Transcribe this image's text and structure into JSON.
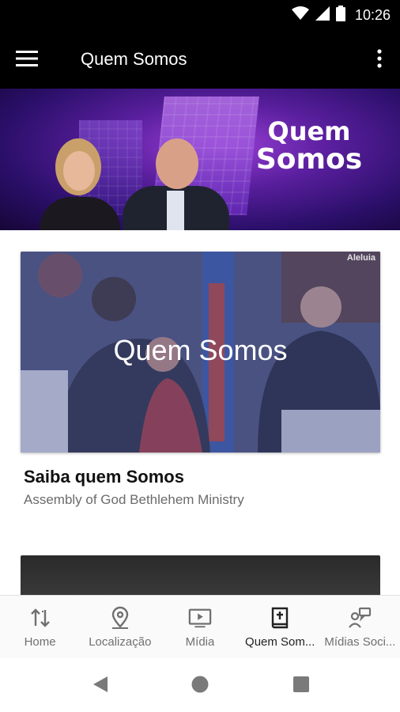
{
  "status_bar": {
    "time": "10:26"
  },
  "app_bar": {
    "title": "Quem Somos"
  },
  "hero": {
    "line1": "Quem",
    "line2": "Somos"
  },
  "card": {
    "overlay_title": "Quem Somos",
    "corner_text": "Aleluia"
  },
  "section": {
    "title": "Saiba quem Somos",
    "subtitle": "Assembly of God Bethlehem Ministry"
  },
  "bottom_nav": {
    "items": [
      {
        "label": "Home",
        "icon": "sort-arrows-icon"
      },
      {
        "label": "Localização",
        "icon": "location-pin-icon"
      },
      {
        "label": "Mídia",
        "icon": "play-video-icon"
      },
      {
        "label": "Quem Som...",
        "icon": "bible-icon"
      },
      {
        "label": "Mídias Soci...",
        "icon": "social-people-icon"
      }
    ]
  },
  "colors": {
    "app_bar": "#000000",
    "nav_background": "#fafafa",
    "hero_purple": "#5a1f9e"
  }
}
